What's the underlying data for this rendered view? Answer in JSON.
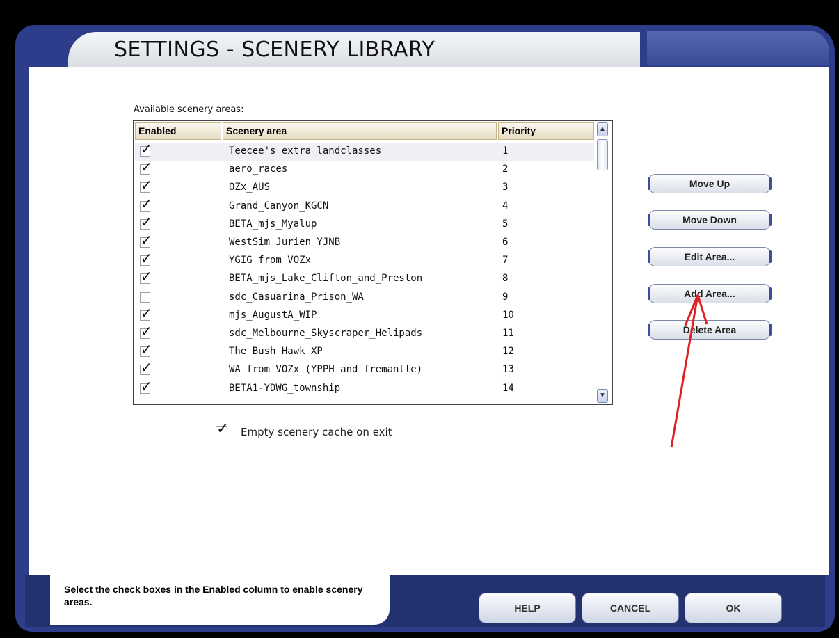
{
  "window": {
    "title": "SETTINGS - SCENERY LIBRARY"
  },
  "list": {
    "label_prefix": "Available ",
    "label_underlined": "s",
    "label_suffix": "cenery areas:",
    "headers": {
      "enabled": "Enabled",
      "area": "Scenery area",
      "priority": "Priority"
    },
    "rows": [
      {
        "enabled": true,
        "area": "Teecee's extra landclasses",
        "priority": "1"
      },
      {
        "enabled": true,
        "area": "aero_races",
        "priority": "2"
      },
      {
        "enabled": true,
        "area": "OZx_AUS",
        "priority": "3"
      },
      {
        "enabled": true,
        "area": "Grand_Canyon_KGCN",
        "priority": "4"
      },
      {
        "enabled": true,
        "area": "BETA_mjs_Myalup",
        "priority": "5"
      },
      {
        "enabled": true,
        "area": "WestSim Jurien YJNB",
        "priority": "6"
      },
      {
        "enabled": true,
        "area": "YGIG from VOZx",
        "priority": "7"
      },
      {
        "enabled": true,
        "area": "BETA_mjs_Lake_Clifton_and_Preston",
        "priority": "8"
      },
      {
        "enabled": false,
        "area": "sdc_Casuarina_Prison_WA",
        "priority": "9"
      },
      {
        "enabled": true,
        "area": "mjs_AugustA_WIP",
        "priority": "10"
      },
      {
        "enabled": true,
        "area": "sdc_Melbourne_Skyscraper_Helipads",
        "priority": "11"
      },
      {
        "enabled": true,
        "area": "The Bush Hawk XP",
        "priority": "12"
      },
      {
        "enabled": true,
        "area": "WA from VOZx (YPPH and fremantle)",
        "priority": "13"
      },
      {
        "enabled": true,
        "area": "BETA1-YDWG_township",
        "priority": "14"
      }
    ]
  },
  "buttons": {
    "move_up": "Move Up",
    "move_down": "Move Down",
    "edit_area": "Edit Area...",
    "add_area": "Add Area...",
    "delete_area": "Delete Area"
  },
  "options": {
    "empty_cache": {
      "label": "Empty scenery cache on exit",
      "checked": true
    }
  },
  "footer": {
    "help_text": "Select the check boxes in the Enabled column to enable scenery areas.",
    "help": "HELP",
    "cancel": "CANCEL",
    "ok": "OK"
  },
  "icons": {
    "check": "check-icon",
    "scroll_up": "scroll-up-arrow-icon",
    "scroll_down": "scroll-down-arrow-icon",
    "annotation_arrow": "annotation-arrow-icon"
  },
  "colors": {
    "frame": "#2d3d8c",
    "annotation": "#e02020"
  }
}
